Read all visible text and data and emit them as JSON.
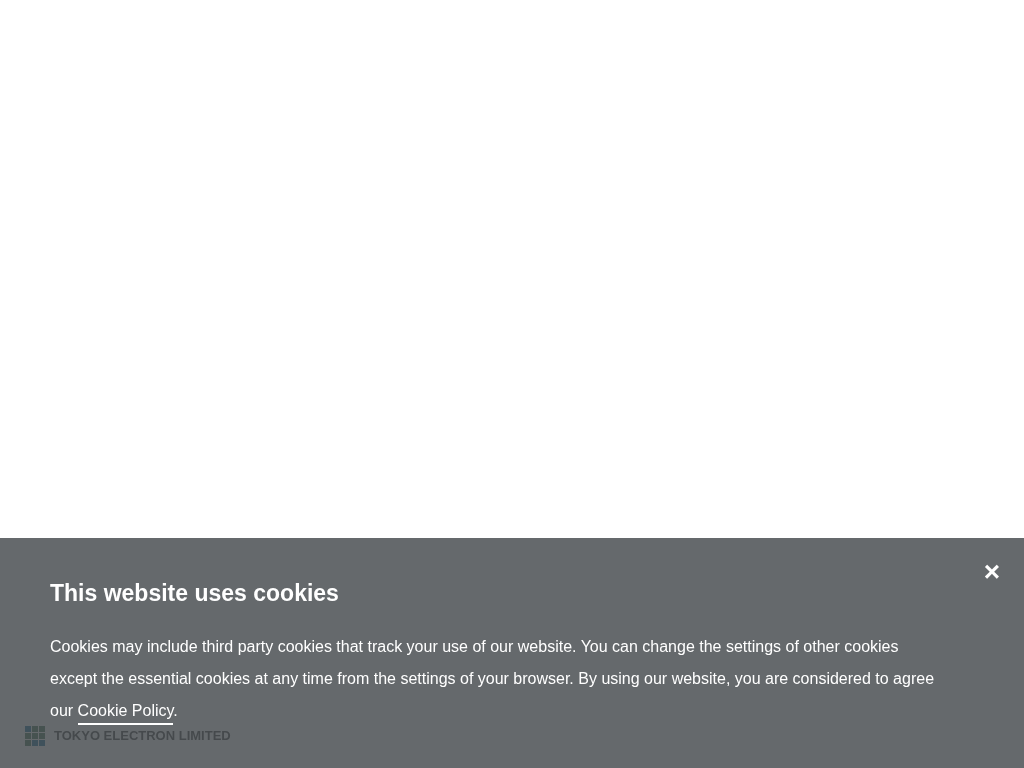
{
  "logo": {
    "text": "TOKYO ELECTRON LIMITED"
  },
  "cookie_banner": {
    "title": "This website uses cookies",
    "body": "Cookies may include third party cookies that track your use of our website. You can change the settings of other cookies except the essential cookies at any time from the settings of your browser. By using our website, you are considered to agree our",
    "link": "Cookie Policy",
    "after_link": ".",
    "close": "×"
  }
}
